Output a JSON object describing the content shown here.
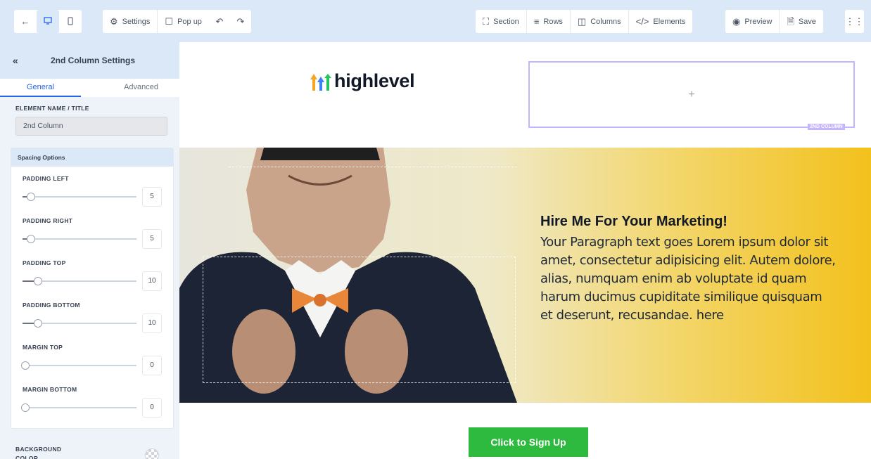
{
  "toolbar": {
    "back_icon": "arrow-left-icon",
    "desktop_icon": "desktop-icon",
    "mobile_icon": "mobile-icon",
    "settings_label": "Settings",
    "popup_label": "Pop up",
    "undo_icon": "undo-icon",
    "redo_icon": "redo-icon",
    "section_label": "Section",
    "rows_label": "Rows",
    "columns_label": "Columns",
    "elements_label": "Elements",
    "preview_label": "Preview",
    "save_label": "Save",
    "grid_icon": "apps-grid-icon"
  },
  "panel": {
    "title": "2nd Column Settings",
    "tabs": [
      {
        "label": "General",
        "active": true
      },
      {
        "label": "Advanced",
        "active": false
      }
    ],
    "element_name_label": "ELEMENT NAME / TITLE",
    "element_name_value": "2nd Column",
    "spacing_title": "Spacing Options",
    "spacing": [
      {
        "label": "PADDING LEFT",
        "value": "5"
      },
      {
        "label": "PADDING RIGHT",
        "value": "5"
      },
      {
        "label": "PADDING TOP",
        "value": "10"
      },
      {
        "label": "PADDING BOTTOM",
        "value": "10"
      },
      {
        "label": "MARGIN TOP",
        "value": "0"
      },
      {
        "label": "MARGIN BOTTOM",
        "value": "0"
      }
    ],
    "background_label": "BACKGROUND COLOR"
  },
  "canvas": {
    "logo_text": "highlevel",
    "column_plus": "+",
    "column_tag": "2ND COLUMN",
    "hero_title": "Hire Me For Your Marketing!",
    "hero_paragraph": "Your Paragraph text goes Lorem ipsum dolor sit amet, consectetur adipisicing elit. Autem dolore, alias, numquam enim ab voluptate id quam harum ducimus cupiditate similique quisquam et deserunt, recusandae. here",
    "cta_label": "Click to Sign Up"
  },
  "colors": {
    "accent": "#2563eb",
    "toolbar_bg": "#dbe8f8",
    "cta_green": "#2dba3e",
    "column_outline": "#c4b5fd",
    "hero_yellow": "#f3c11d"
  }
}
